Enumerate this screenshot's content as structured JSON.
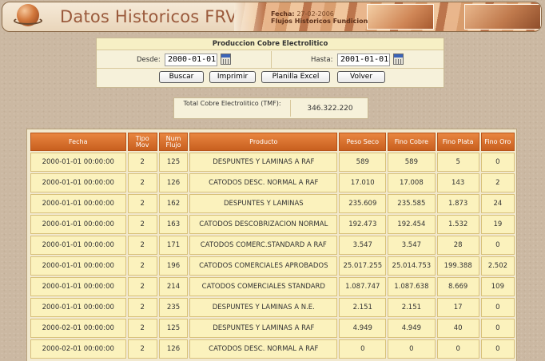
{
  "header": {
    "title": "Datos Historicos FRV",
    "fecha_label": "Fecha:",
    "fecha_value": "27-02-2006",
    "subtitle": "Flujos Historicos Fundicion"
  },
  "filter": {
    "title": "Produccion Cobre Electrolitico",
    "desde_label": "Desde:",
    "desde_value": "2000-01-01",
    "hasta_label": "Hasta:",
    "hasta_value": "2001-01-01",
    "buttons": {
      "buscar": "Buscar",
      "imprimir": "Imprimir",
      "planilla": "Planilla Excel",
      "volver": "Volver"
    }
  },
  "total": {
    "label": "Total Cobre Electrolitico (TMF):",
    "value": "346.322.220"
  },
  "table": {
    "headers": [
      "Fecha",
      "Tipo Mov",
      "Num Flujo",
      "Producto",
      "Peso Seco",
      "Fino Cobre",
      "Fino Plata",
      "Fino Oro"
    ],
    "rows": [
      [
        "2000-01-01 00:00:00",
        "2",
        "125",
        "DESPUNTES Y LAMINAS A RAF",
        "589",
        "589",
        "5",
        "0"
      ],
      [
        "2000-01-01 00:00:00",
        "2",
        "126",
        "CATODOS DESC. NORMAL A RAF",
        "17.010",
        "17.008",
        "143",
        "2"
      ],
      [
        "2000-01-01 00:00:00",
        "2",
        "162",
        "DESPUNTES Y LAMINAS",
        "235.609",
        "235.585",
        "1.873",
        "24"
      ],
      [
        "2000-01-01 00:00:00",
        "2",
        "163",
        "CATODOS DESCOBRIZACION NORMAL",
        "192.473",
        "192.454",
        "1.532",
        "19"
      ],
      [
        "2000-01-01 00:00:00",
        "2",
        "171",
        "CATODOS COMERC.STANDARD A RAF",
        "3.547",
        "3.547",
        "28",
        "0"
      ],
      [
        "2000-01-01 00:00:00",
        "2",
        "196",
        "CATODOS COMERCIALES APROBADOS",
        "25.017.255",
        "25.014.753",
        "199.388",
        "2.502"
      ],
      [
        "2000-01-01 00:00:00",
        "2",
        "214",
        "CATODOS COMERCIALES STANDARD",
        "1.087.747",
        "1.087.638",
        "8.669",
        "109"
      ],
      [
        "2000-01-01 00:00:00",
        "2",
        "235",
        "DESPUNTES Y LAMINAS A N.E.",
        "2.151",
        "2.151",
        "17",
        "0"
      ],
      [
        "2000-02-01 00:00:00",
        "2",
        "125",
        "DESPUNTES Y LAMINAS A RAF",
        "4.949",
        "4.949",
        "40",
        "0"
      ],
      [
        "2000-02-01 00:00:00",
        "2",
        "126",
        "CATODOS DESC. NORMAL A RAF",
        "0",
        "0",
        "0",
        "0"
      ]
    ]
  },
  "colors": {
    "header_orange": "#d8702e",
    "cell_yellow": "#fbf2bd",
    "title_brown": "#9a5a3c"
  }
}
